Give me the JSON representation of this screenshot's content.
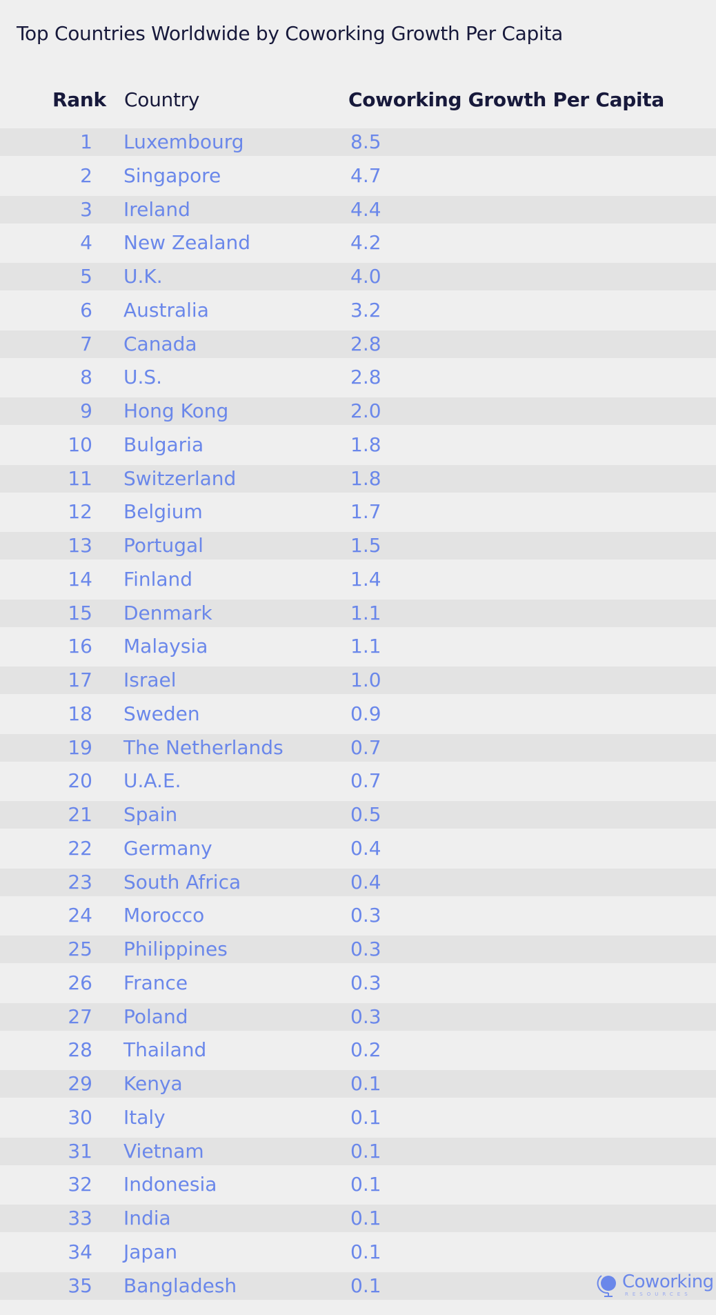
{
  "chart_data": {
    "type": "table",
    "title": "Top Countries Worldwide by Coworking Growth Per Capita",
    "columns": [
      "Rank",
      "Country",
      "Coworking Growth Per Capita"
    ],
    "rows": [
      {
        "rank": "1",
        "country": "Luxembourg",
        "value": "8.5"
      },
      {
        "rank": "2",
        "country": "Singapore",
        "value": "4.7"
      },
      {
        "rank": "3",
        "country": "Ireland",
        "value": "4.4"
      },
      {
        "rank": "4",
        "country": "New Zealand",
        "value": "4.2"
      },
      {
        "rank": "5",
        "country": "U.K.",
        "value": "4.0"
      },
      {
        "rank": "6",
        "country": "Australia",
        "value": "3.2"
      },
      {
        "rank": "7",
        "country": "Canada",
        "value": "2.8"
      },
      {
        "rank": "8",
        "country": "U.S.",
        "value": "2.8"
      },
      {
        "rank": "9",
        "country": "Hong Kong",
        "value": "2.0"
      },
      {
        "rank": "10",
        "country": "Bulgaria",
        "value": "1.8"
      },
      {
        "rank": "11",
        "country": "Switzerland",
        "value": "1.8"
      },
      {
        "rank": "12",
        "country": "Belgium",
        "value": "1.7"
      },
      {
        "rank": "13",
        "country": "Portugal",
        "value": "1.5"
      },
      {
        "rank": "14",
        "country": "Finland",
        "value": "1.4"
      },
      {
        "rank": "15",
        "country": "Denmark",
        "value": "1.1"
      },
      {
        "rank": "16",
        "country": "Malaysia",
        "value": "1.1"
      },
      {
        "rank": "17",
        "country": "Israel",
        "value": "1.0"
      },
      {
        "rank": "18",
        "country": "Sweden",
        "value": "0.9"
      },
      {
        "rank": "19",
        "country": "The Netherlands",
        "value": "0.7"
      },
      {
        "rank": "20",
        "country": "U.A.E.",
        "value": "0.7"
      },
      {
        "rank": "21",
        "country": "Spain",
        "value": "0.5"
      },
      {
        "rank": "22",
        "country": "Germany",
        "value": "0.4"
      },
      {
        "rank": "23",
        "country": "South Africa",
        "value": "0.4"
      },
      {
        "rank": "24",
        "country": "Morocco",
        "value": "0.3"
      },
      {
        "rank": "25",
        "country": "Philippines",
        "value": "0.3"
      },
      {
        "rank": "26",
        "country": "France",
        "value": "0.3"
      },
      {
        "rank": "27",
        "country": "Poland",
        "value": "0.3"
      },
      {
        "rank": "28",
        "country": "Thailand",
        "value": "0.2"
      },
      {
        "rank": "29",
        "country": "Kenya",
        "value": "0.1"
      },
      {
        "rank": "30",
        "country": "Italy",
        "value": "0.1"
      },
      {
        "rank": "31",
        "country": "Vietnam",
        "value": "0.1"
      },
      {
        "rank": "32",
        "country": "Indonesia",
        "value": "0.1"
      },
      {
        "rank": "33",
        "country": "India",
        "value": "0.1"
      },
      {
        "rank": "34",
        "country": "Japan",
        "value": "0.1"
      },
      {
        "rank": "35",
        "country": "Bangladesh",
        "value": "0.1"
      }
    ]
  },
  "logo": {
    "icon": "globe-icon",
    "name": "Coworking",
    "subtitle": "RESOURCES"
  },
  "colors": {
    "title": "#17193b",
    "values": "#6a87ea",
    "band": "#e3e3e3",
    "background": "#efefef"
  }
}
